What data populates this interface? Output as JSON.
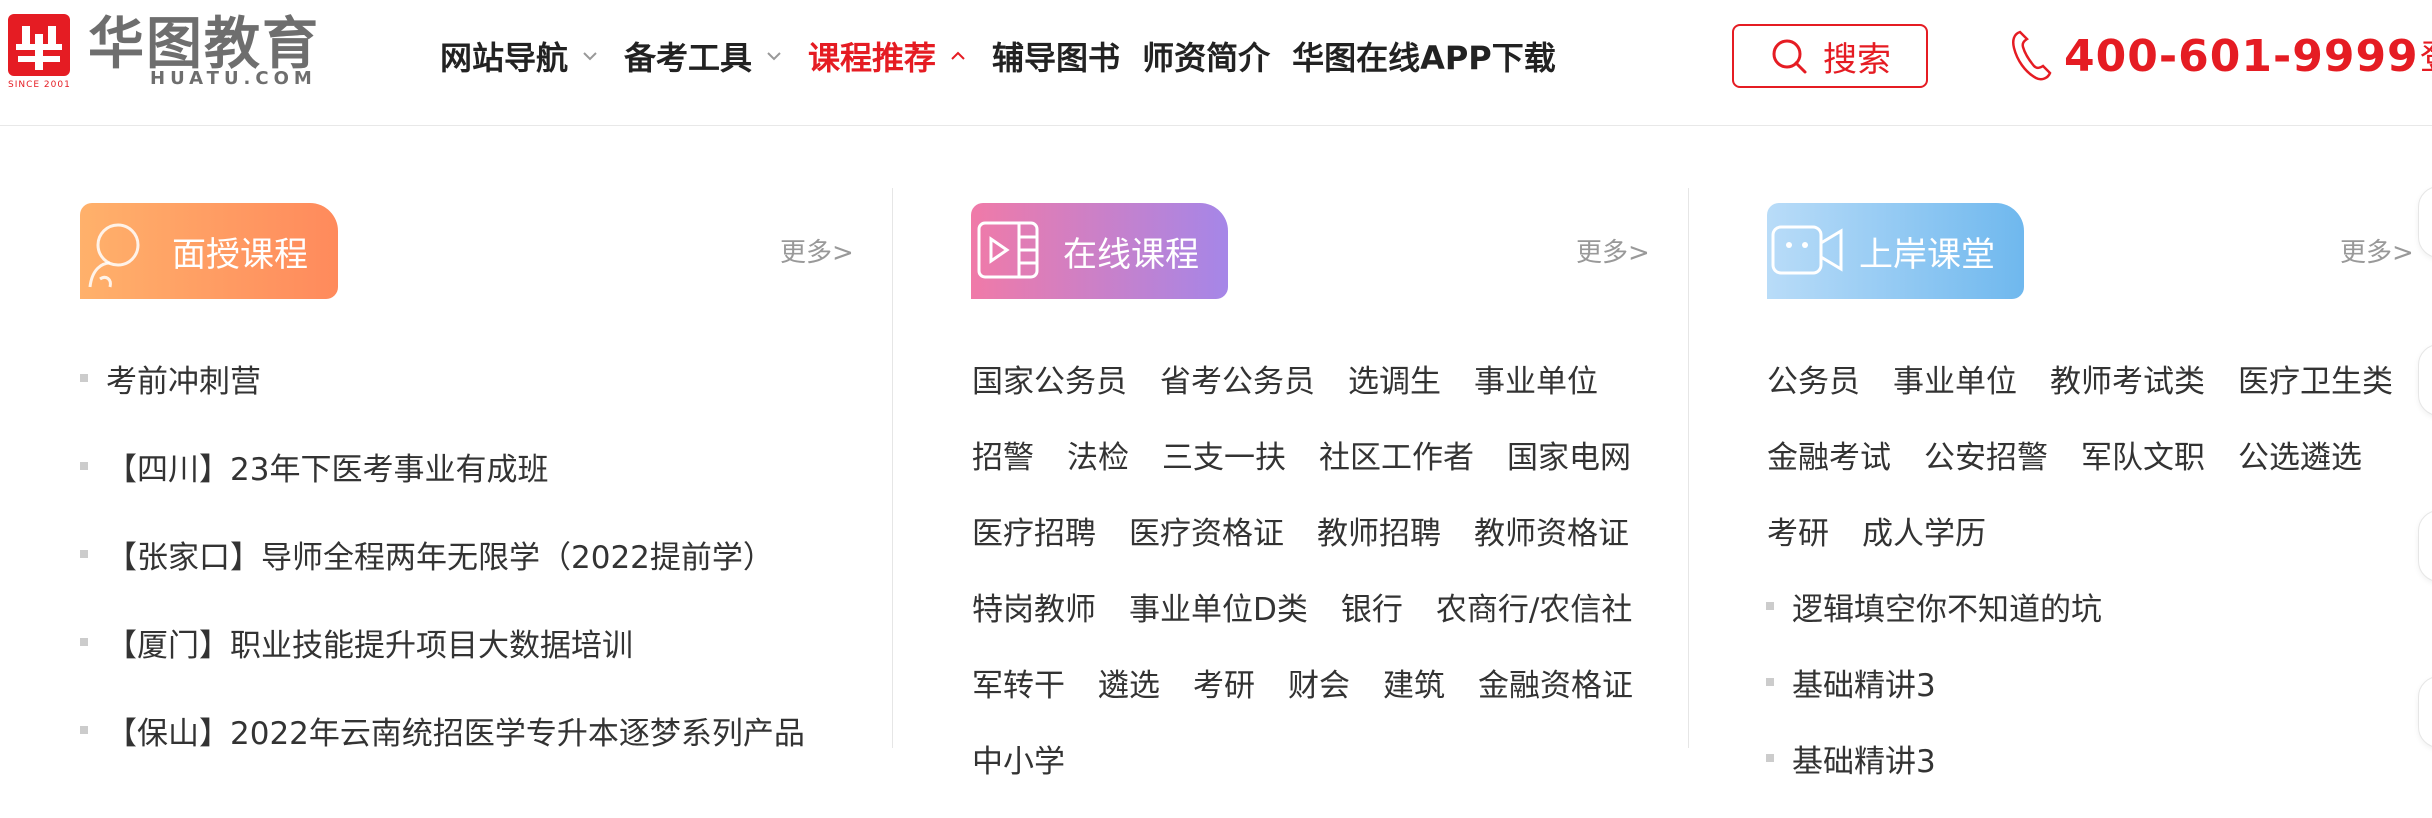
{
  "brand": {
    "logo_cn": "华图教育",
    "logo_en": "HUATU.COM",
    "since": "SINCE 2001"
  },
  "nav": [
    {
      "label": "网站导航",
      "chevron": "down",
      "active": false
    },
    {
      "label": "备考工具",
      "chevron": "down",
      "active": false
    },
    {
      "label": "课程推荐",
      "chevron": "up",
      "active": true
    },
    {
      "label": "辅导图书",
      "chevron": "",
      "active": false
    },
    {
      "label": "师资简介",
      "chevron": "",
      "active": false
    },
    {
      "label": "华图在线APP下载",
      "chevron": "",
      "active": false
    }
  ],
  "search": {
    "label": "搜索"
  },
  "phone": {
    "number": "400-601-9999"
  },
  "colors": {
    "brand_red": "#e51c23"
  },
  "columns": {
    "face": {
      "title": "面授课程",
      "more": "更多>",
      "items": [
        "考前冲刺营",
        "【四川】23年下医考事业有成班",
        "【张家口】导师全程两年无限学（2022提前学）",
        "【厦门】职业技能提升项目大数据培训",
        "【保山】2022年云南统招医学专升本逐梦系列产品"
      ]
    },
    "online": {
      "title": "在线课程",
      "more": "更多>",
      "rows": [
        [
          "国家公务员",
          "省考公务员",
          "选调生",
          "事业单位"
        ],
        [
          "招警",
          "法检",
          "三支一扶",
          "社区工作者",
          "国家电网"
        ],
        [
          "医疗招聘",
          "医疗资格证",
          "教师招聘",
          "教师资格证"
        ],
        [
          "特岗教师",
          "事业单位D类",
          "银行",
          "农商行/农信社"
        ],
        [
          "军转干",
          "遴选",
          "考研",
          "财会",
          "建筑",
          "金融资格证"
        ],
        [
          "中小学"
        ]
      ]
    },
    "shore": {
      "title": "上岸课堂",
      "more": "更多>",
      "rows": [
        [
          "公务员",
          "事业单位",
          "教师考试类",
          "医疗卫生类"
        ],
        [
          "金融考试",
          "公安招警",
          "军队文职",
          "公选遴选"
        ],
        [
          "考研",
          "成人学历"
        ]
      ],
      "items": [
        "逻辑填空你不知道的坑",
        "基础精讲3",
        "基础精讲3"
      ]
    }
  }
}
